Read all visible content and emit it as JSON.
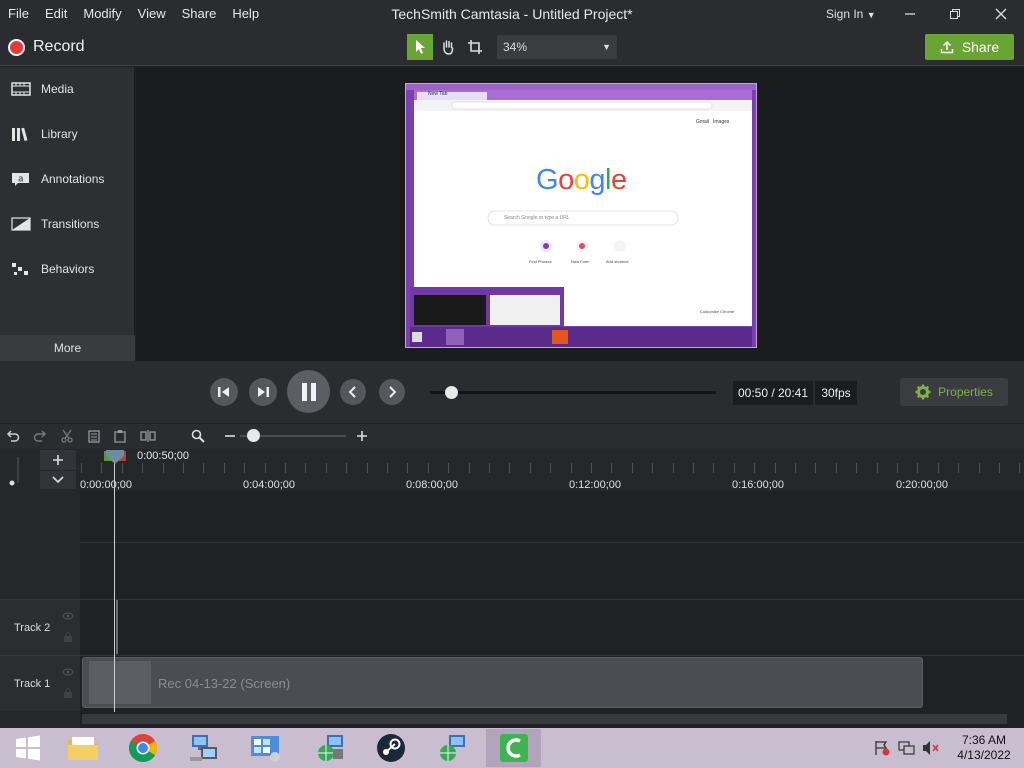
{
  "app": {
    "title": "TechSmith Camtasia - Untitled Project*",
    "menu": [
      "File",
      "Edit",
      "Modify",
      "View",
      "Share",
      "Help"
    ],
    "sign_in": "Sign In"
  },
  "toolbar": {
    "record_label": "Record",
    "zoom_value": "34%",
    "share_label": "Share"
  },
  "sidebar": {
    "items": [
      {
        "label": "Media",
        "icon": "film-icon"
      },
      {
        "label": "Library",
        "icon": "library-icon"
      },
      {
        "label": "Annotations",
        "icon": "annotation-icon"
      },
      {
        "label": "Transitions",
        "icon": "transition-icon"
      },
      {
        "label": "Behaviors",
        "icon": "behaviors-icon"
      }
    ],
    "more_label": "More"
  },
  "playback": {
    "time": "00:50 / 20:41",
    "fps": "30fps",
    "properties_label": "Properties",
    "progress_fraction": 0.04
  },
  "timeline": {
    "playhead_time": "0:00:50;00",
    "ticks": [
      "0:00:00;00",
      "0:04:00;00",
      "0:08:00;00",
      "0:12:00;00",
      "0:16:00;00",
      "0:20:00;00"
    ],
    "tracks": [
      {
        "label": "Track 2"
      },
      {
        "label": "Track 1"
      }
    ],
    "clip_name": "Rec 04-13-22 (Screen)"
  },
  "preview": {
    "tab_label": "New Tab",
    "links": [
      "Gmail",
      "Images"
    ],
    "logo_letters": [
      "G",
      "o",
      "o",
      "g",
      "l",
      "e"
    ],
    "logo_colors": [
      "#4285f4",
      "#ea4335",
      "#fbbc05",
      "#4285f4",
      "#34a853",
      "#ea4335"
    ],
    "search_placeholder": "Search Google or type a URL",
    "shortcuts": [
      "Find Phones",
      "New Form",
      "Add shortcut"
    ],
    "customize": "Customize Chrome"
  },
  "taskbar": {
    "time": "7:36 AM",
    "date": "4/13/2022"
  },
  "colors": {
    "accent_green": "#6aa434",
    "record_red": "#e03c3c",
    "preview_purple": "#7b3fb0"
  }
}
